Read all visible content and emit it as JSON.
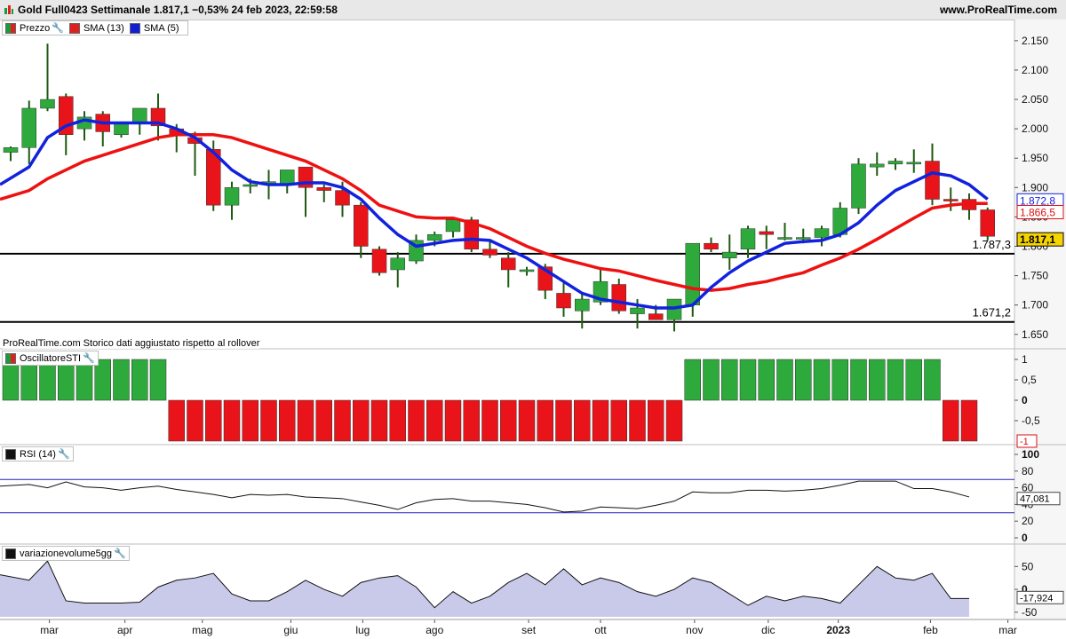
{
  "header": {
    "title": "Gold Full0423 Settimanale 1.817,1 −0,53% 24 feb 2023, 22:59:58",
    "site": "www.ProRealTime.com"
  },
  "legends": {
    "main": [
      {
        "label": "Prezzo",
        "color": "#1a9a3a"
      },
      {
        "label": "SMA (13)",
        "color": "#e02020"
      },
      {
        "label": "SMA (5)",
        "color": "#1020d0"
      }
    ],
    "sti": "OscillatoreSTI",
    "rsi": "RSI (14)",
    "vol": "variazionevolume5gg"
  },
  "note": "ProRealTime.com Storico dati aggiustato rispetto al rollover",
  "colors": {
    "up": "#2eaa3c",
    "down": "#e8141a",
    "sma13": "#ee1111",
    "sma5": "#1122dd",
    "axis_bg": "#f6f6f6"
  },
  "chart_data": [
    {
      "type": "candlestick",
      "title": "Gold Full0423 Settimanale",
      "ylim": [
        1630,
        2180
      ],
      "y_ticks": [
        "2.150",
        "2.100",
        "2.050",
        "2.000",
        "1.950",
        "1.900",
        "1.850",
        "1.800",
        "1.750",
        "1.700",
        "1.650"
      ],
      "x_labels": [
        "mar",
        "apr",
        "mag",
        "giu",
        "lug",
        "ago",
        "set",
        "ott",
        "nov",
        "dic",
        "2023",
        "feb",
        "mar"
      ],
      "candles": [
        [
          1960,
          1970,
          1945,
          1968
        ],
        [
          1968,
          2048,
          1940,
          2035
        ],
        [
          2035,
          2145,
          2030,
          2050
        ],
        [
          2055,
          2060,
          1955,
          1990
        ],
        [
          2000,
          2030,
          1980,
          2020
        ],
        [
          2025,
          2030,
          1970,
          1995
        ],
        [
          1990,
          2010,
          1985,
          2010
        ],
        [
          2010,
          2030,
          1990,
          2035
        ],
        [
          2035,
          2060,
          1980,
          2005
        ],
        [
          2000,
          2008,
          1960,
          1990
        ],
        [
          1985,
          1995,
          1920,
          1975
        ],
        [
          1965,
          1980,
          1860,
          1870
        ],
        [
          1870,
          1910,
          1845,
          1900
        ],
        [
          1905,
          1915,
          1890,
          1905
        ],
        [
          1905,
          1930,
          1880,
          1910
        ],
        [
          1905,
          1930,
          1890,
          1930
        ],
        [
          1935,
          1935,
          1850,
          1900
        ],
        [
          1900,
          1905,
          1875,
          1895
        ],
        [
          1895,
          1910,
          1850,
          1870
        ],
        [
          1870,
          1875,
          1780,
          1800
        ],
        [
          1795,
          1800,
          1750,
          1755
        ],
        [
          1760,
          1790,
          1730,
          1780
        ],
        [
          1775,
          1820,
          1770,
          1810
        ],
        [
          1810,
          1825,
          1800,
          1820
        ],
        [
          1825,
          1850,
          1815,
          1845
        ],
        [
          1845,
          1850,
          1790,
          1795
        ],
        [
          1795,
          1810,
          1780,
          1785
        ],
        [
          1780,
          1790,
          1730,
          1760
        ],
        [
          1760,
          1765,
          1750,
          1760
        ],
        [
          1765,
          1770,
          1710,
          1725
        ],
        [
          1720,
          1740,
          1680,
          1695
        ],
        [
          1690,
          1720,
          1660,
          1710
        ],
        [
          1705,
          1760,
          1700,
          1740
        ],
        [
          1735,
          1745,
          1685,
          1690
        ],
        [
          1685,
          1710,
          1660,
          1695
        ],
        [
          1685,
          1700,
          1675,
          1675
        ],
        [
          1675,
          1710,
          1655,
          1710
        ],
        [
          1700,
          1790,
          1680,
          1805
        ],
        [
          1805,
          1815,
          1790,
          1795
        ],
        [
          1780,
          1820,
          1760,
          1790
        ],
        [
          1795,
          1835,
          1780,
          1830
        ],
        [
          1825,
          1835,
          1795,
          1820
        ],
        [
          1815,
          1840,
          1810,
          1815
        ],
        [
          1815,
          1830,
          1805,
          1815
        ],
        [
          1815,
          1835,
          1800,
          1830
        ],
        [
          1820,
          1875,
          1815,
          1865
        ],
        [
          1865,
          1950,
          1855,
          1940
        ],
        [
          1935,
          1960,
          1920,
          1940
        ],
        [
          1940,
          1950,
          1930,
          1945
        ],
        [
          1940,
          1965,
          1925,
          1943
        ],
        [
          1945,
          1975,
          1870,
          1880
        ],
        [
          1880,
          1900,
          1860,
          1877
        ],
        [
          1880,
          1890,
          1845,
          1862
        ],
        [
          1862,
          1866,
          1810,
          1817
        ]
      ],
      "sma13": [
        1880,
        1895,
        1915,
        1930,
        1945,
        1955,
        1965,
        1975,
        1985,
        1990,
        1990,
        1990,
        1985,
        1975,
        1965,
        1955,
        1945,
        1930,
        1915,
        1895,
        1870,
        1860,
        1850,
        1848,
        1848,
        1840,
        1830,
        1815,
        1800,
        1788,
        1778,
        1770,
        1762,
        1758,
        1750,
        1742,
        1735,
        1728,
        1725,
        1728,
        1735,
        1740,
        1748,
        1755,
        1768,
        1780,
        1795,
        1812,
        1830,
        1848,
        1865,
        1870,
        1873,
        1872.8
      ],
      "sma5": [
        1905,
        1935,
        1985,
        2005,
        2015,
        2010,
        2010,
        2010,
        2010,
        2000,
        1985,
        1960,
        1930,
        1910,
        1905,
        1905,
        1908,
        1908,
        1900,
        1880,
        1848,
        1820,
        1800,
        1805,
        1810,
        1812,
        1810,
        1795,
        1780,
        1760,
        1740,
        1720,
        1710,
        1705,
        1700,
        1695,
        1695,
        1700,
        1730,
        1755,
        1775,
        1790,
        1805,
        1808,
        1810,
        1820,
        1840,
        1870,
        1895,
        1910,
        1925,
        1920,
        1905,
        1880
      ],
      "levels": [
        "1.787,3",
        "1.671,2"
      ],
      "level_values": [
        1787.3,
        1671.2
      ],
      "axis_labels": {
        "sma5": "1.872,8",
        "sma13": "1.866,5",
        "price": "1.817,1"
      }
    },
    {
      "type": "bar",
      "title": "OscillatoreSTI",
      "ylim": [
        -1,
        1
      ],
      "y_ticks": [
        "1",
        "0,5",
        "0",
        "-0,5"
      ],
      "value_label": "-1",
      "values": [
        1,
        1,
        1,
        1,
        1,
        1,
        1,
        1,
        1,
        -1,
        -1,
        -1,
        -1,
        -1,
        -1,
        -1,
        -1,
        -1,
        -1,
        -1,
        -1,
        -1,
        -1,
        -1,
        -1,
        -1,
        -1,
        -1,
        -1,
        -1,
        -1,
        -1,
        -1,
        -1,
        -1,
        -1,
        -1,
        1,
        1,
        1,
        1,
        1,
        1,
        1,
        1,
        1,
        1,
        1,
        1,
        1,
        1,
        -1,
        -1
      ]
    },
    {
      "type": "line",
      "title": "RSI (14)",
      "ylim": [
        0,
        100
      ],
      "y_ticks": [
        "100",
        "80",
        "60",
        "40",
        "20",
        "0"
      ],
      "bands": [
        70,
        30
      ],
      "value_label": "47,081",
      "values": [
        62,
        64,
        60,
        67,
        61,
        60,
        57,
        60,
        62,
        58,
        55,
        52,
        48,
        52,
        51,
        52,
        49,
        48,
        47,
        43,
        39,
        34,
        42,
        46,
        47,
        44,
        44,
        42,
        40,
        36,
        31,
        32,
        37,
        36,
        35,
        39,
        44,
        55,
        54,
        54,
        57,
        57,
        56,
        57,
        59,
        63,
        68,
        68,
        68,
        59,
        59,
        55,
        49
      ]
    },
    {
      "type": "area",
      "title": "variazionevolume5gg",
      "ylim": [
        -60,
        70
      ],
      "y_ticks": [
        "50",
        "0",
        "-50"
      ],
      "value_label": "-17,924",
      "values": [
        32,
        20,
        62,
        -25,
        -30,
        -30,
        -30,
        -28,
        5,
        20,
        25,
        35,
        -10,
        -25,
        -25,
        -5,
        20,
        0,
        -15,
        15,
        25,
        30,
        5,
        -40,
        -5,
        -30,
        -15,
        15,
        35,
        10,
        45,
        10,
        25,
        15,
        -5,
        -15,
        0,
        25,
        15,
        -10,
        -35,
        -15,
        -25,
        -15,
        -20,
        -30,
        10,
        50,
        25,
        20,
        35,
        -20,
        -20
      ]
    }
  ]
}
